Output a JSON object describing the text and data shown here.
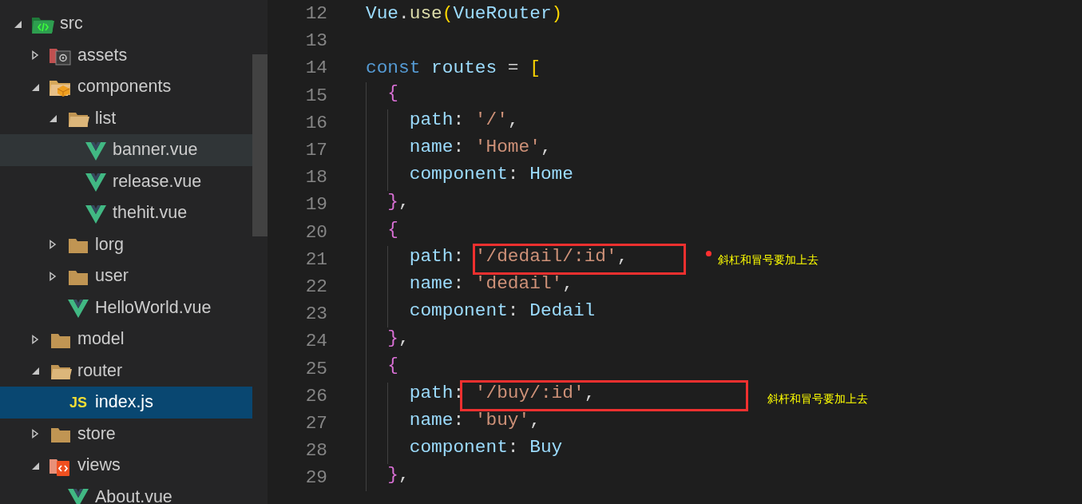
{
  "explorer": {
    "items": [
      {
        "label": "src",
        "kind": "src-folder",
        "expanded": true,
        "selected": false,
        "hovered": false,
        "children": [
          {
            "label": "assets",
            "kind": "assets-folder",
            "expanded": false,
            "selected": false,
            "hovered": false
          },
          {
            "label": "components",
            "kind": "components-folder",
            "expanded": true,
            "selected": false,
            "hovered": false,
            "children": [
              {
                "label": "list",
                "kind": "folder",
                "expanded": true,
                "selected": false,
                "hovered": false,
                "children": [
                  {
                    "label": "banner.vue",
                    "kind": "vue",
                    "selected": false,
                    "hovered": true
                  },
                  {
                    "label": "release.vue",
                    "kind": "vue",
                    "selected": false,
                    "hovered": false
                  },
                  {
                    "label": "thehit.vue",
                    "kind": "vue",
                    "selected": false,
                    "hovered": false
                  }
                ]
              },
              {
                "label": "lorg",
                "kind": "folder",
                "expanded": false,
                "selected": false,
                "hovered": false
              },
              {
                "label": "user",
                "kind": "folder",
                "expanded": false,
                "selected": false,
                "hovered": false
              },
              {
                "label": "HelloWorld.vue",
                "kind": "vue",
                "selected": false,
                "hovered": false
              }
            ]
          },
          {
            "label": "model",
            "kind": "folder",
            "expanded": false,
            "selected": false,
            "hovered": false
          },
          {
            "label": "router",
            "kind": "folder",
            "expanded": true,
            "selected": false,
            "hovered": false,
            "children": [
              {
                "label": "index.js",
                "kind": "js",
                "badge": "JS",
                "selected": true,
                "hovered": false
              }
            ]
          },
          {
            "label": "store",
            "kind": "folder",
            "expanded": false,
            "selected": false,
            "hovered": false
          },
          {
            "label": "views",
            "kind": "views-folder",
            "expanded": true,
            "selected": false,
            "hovered": false,
            "children": [
              {
                "label": "About.vue",
                "kind": "vue",
                "selected": false,
                "hovered": false
              }
            ]
          }
        ]
      }
    ]
  },
  "editor": {
    "lines": [
      {
        "number": "12",
        "tokens": [
          {
            "kind": "variable",
            "text": "Vue"
          },
          {
            "kind": "punct",
            "text": "."
          },
          {
            "kind": "function",
            "text": "use"
          },
          {
            "kind": "bracket1",
            "text": "("
          },
          {
            "kind": "variable",
            "text": "VueRouter"
          },
          {
            "kind": "bracket1",
            "text": ")"
          }
        ]
      },
      {
        "number": "13"
      },
      {
        "number": "14",
        "tokens": [
          {
            "kind": "keyword",
            "text": "const "
          },
          {
            "kind": "variable",
            "text": "routes"
          },
          {
            "kind": "punct",
            "text": " = "
          },
          {
            "kind": "bracket1",
            "text": "["
          }
        ]
      },
      {
        "number": "15",
        "tokens": [
          {
            "kind": "bracket2",
            "text": "  {"
          }
        ]
      },
      {
        "number": "16",
        "tokens": [
          {
            "kind": "variable",
            "text": "    path"
          },
          {
            "kind": "punct",
            "text": ": "
          },
          {
            "kind": "string",
            "text": "'/'"
          },
          {
            "kind": "punct",
            "text": ","
          }
        ]
      },
      {
        "number": "17",
        "tokens": [
          {
            "kind": "variable",
            "text": "    name"
          },
          {
            "kind": "punct",
            "text": ": "
          },
          {
            "kind": "string",
            "text": "'Home'"
          },
          {
            "kind": "punct",
            "text": ","
          }
        ]
      },
      {
        "number": "18",
        "tokens": [
          {
            "kind": "variable",
            "text": "    component"
          },
          {
            "kind": "punct",
            "text": ": "
          },
          {
            "kind": "variable",
            "text": "Home"
          }
        ]
      },
      {
        "number": "19",
        "tokens": [
          {
            "kind": "bracket2",
            "text": "  }"
          },
          {
            "kind": "punct",
            "text": ","
          }
        ]
      },
      {
        "number": "20",
        "tokens": [
          {
            "kind": "bracket2",
            "text": "  {"
          }
        ]
      },
      {
        "number": "21",
        "tokens": [
          {
            "kind": "variable",
            "text": "    path"
          },
          {
            "kind": "punct",
            "text": ": "
          },
          {
            "kind": "string",
            "text": "'/dedail/:id'"
          },
          {
            "kind": "punct",
            "text": ","
          }
        ],
        "note": {
          "text": "斜杠和冒号要加上去",
          "dot": true
        }
      },
      {
        "number": "22",
        "tokens": [
          {
            "kind": "variable",
            "text": "    name"
          },
          {
            "kind": "punct",
            "text": ": "
          },
          {
            "kind": "string",
            "text": "'dedail'"
          },
          {
            "kind": "punct",
            "text": ","
          }
        ]
      },
      {
        "number": "23",
        "tokens": [
          {
            "kind": "variable",
            "text": "    component"
          },
          {
            "kind": "punct",
            "text": ": "
          },
          {
            "kind": "variable",
            "text": "Dedail"
          }
        ]
      },
      {
        "number": "24",
        "tokens": [
          {
            "kind": "bracket2",
            "text": "  }"
          },
          {
            "kind": "punct",
            "text": ","
          }
        ]
      },
      {
        "number": "25",
        "tokens": [
          {
            "kind": "bracket2",
            "text": "  {"
          }
        ]
      },
      {
        "number": "26",
        "tokens": [
          {
            "kind": "variable",
            "text": "    path"
          },
          {
            "kind": "punct",
            "text": ": "
          },
          {
            "kind": "string",
            "text": "'/buy/:id'"
          },
          {
            "kind": "punct",
            "text": ","
          }
        ],
        "note": {
          "text": "斜杆和冒号要加上去",
          "dot": false
        }
      },
      {
        "number": "27",
        "tokens": [
          {
            "kind": "variable",
            "text": "    name"
          },
          {
            "kind": "punct",
            "text": ": "
          },
          {
            "kind": "string",
            "text": "'buy'"
          },
          {
            "kind": "punct",
            "text": ","
          }
        ]
      },
      {
        "number": "28",
        "tokens": [
          {
            "kind": "variable",
            "text": "    component"
          },
          {
            "kind": "punct",
            "text": ": "
          },
          {
            "kind": "variable",
            "text": "Buy"
          }
        ]
      },
      {
        "number": "29",
        "tokens": [
          {
            "kind": "bracket2",
            "text": "  }"
          },
          {
            "kind": "punct",
            "text": ","
          }
        ]
      }
    ]
  }
}
